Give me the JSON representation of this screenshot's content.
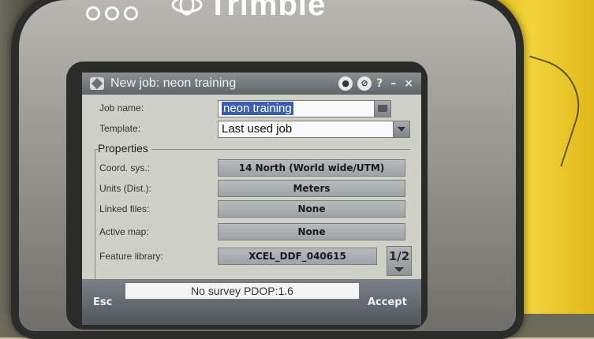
{
  "device": {
    "brand": "Trimble"
  },
  "window": {
    "title": "New job: neon training",
    "help_label": "?",
    "minimize_label": "–",
    "close_label": "×"
  },
  "job_name": {
    "label": "Job name:",
    "value": "neon training"
  },
  "template": {
    "label": "Template:",
    "value": "Last used job"
  },
  "properties": {
    "group_label": "Properties",
    "items": [
      {
        "label": "Coord. sys.:",
        "value": "14 North (World wide/UTM)"
      },
      {
        "label": "Units (Dist.):",
        "value": "Meters"
      },
      {
        "label": "Linked files:",
        "value": "None"
      },
      {
        "label": "Active map:",
        "value": "None"
      },
      {
        "label": "Feature library:",
        "value": "XCEL_DDF_040615"
      }
    ],
    "page_indicator": "1/2"
  },
  "status_bar": {
    "text": "No survey  PDOP:1.6"
  },
  "softkeys": {
    "left": "Esc",
    "right": "Accept"
  }
}
